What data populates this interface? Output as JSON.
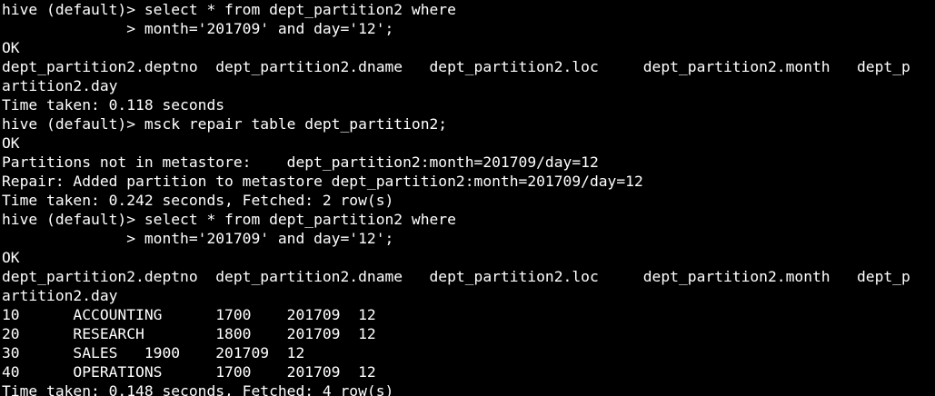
{
  "terminal": {
    "colors": {
      "background": "#000000",
      "foreground": "#ffffff"
    },
    "lines": [
      "hive (default)> select * from dept_partition2 where",
      "              > month='201709' and day='12';",
      "OK",
      "dept_partition2.deptno  dept_partition2.dname   dept_partition2.loc     dept_partition2.month   dept_p",
      "artition2.day",
      "Time taken: 0.118 seconds",
      "hive (default)> msck repair table dept_partition2;",
      "OK",
      "Partitions not in metastore:    dept_partition2:month=201709/day=12",
      "Repair: Added partition to metastore dept_partition2:month=201709/day=12",
      "Time taken: 0.242 seconds, Fetched: 2 row(s)",
      "hive (default)> select * from dept_partition2 where",
      "              > month='201709' and day='12';",
      "OK",
      "dept_partition2.deptno  dept_partition2.dname   dept_partition2.loc     dept_partition2.month   dept_p",
      "artition2.day",
      "10      ACCOUNTING      1700    201709  12",
      "20      RESEARCH        1800    201709  12",
      "30      SALES   1900    201709  12",
      "40      OPERATIONS      1700    201709  12",
      "Time taken: 0.148 seconds, Fetched: 4 row(s)"
    ]
  }
}
